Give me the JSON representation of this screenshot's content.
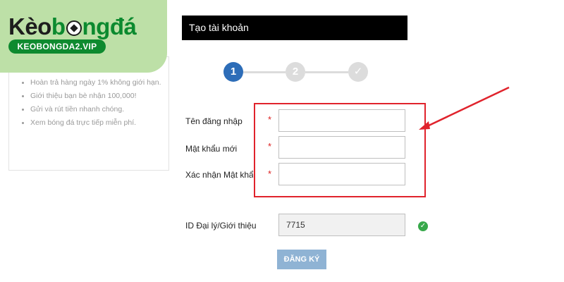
{
  "logo": {
    "part1": "Kèo",
    "part2": "b",
    "part3": "ngđá",
    "domain": "KEOBONGDA2.VIP"
  },
  "promo": {
    "top_text": "...",
    "items": [
      "Hoàn trả hàng ngày 1% không giới hạn.",
      "Giới thiệu bạn bè nhận 100,000!",
      "Gửi và rút tiền nhanh chóng.",
      "Xem bóng đá trực tiếp miễn phí."
    ]
  },
  "header": {
    "title": "Tạo tài khoản"
  },
  "stepper": {
    "steps": [
      "1",
      "2",
      "✓"
    ],
    "active_color": "#2d6db8",
    "inactive_color": "#dcdcdc"
  },
  "form": {
    "username_label": "Tên đăng nhập",
    "password_label": "Mật khẩu mới",
    "confirm_label": "Xác nhận Mật khẩu",
    "required_mark": "*",
    "username_value": "",
    "password_value": "",
    "confirm_value": "",
    "agent_label": "ID Đại lý/Giới thiệu",
    "agent_value": "7715",
    "submit_label": "ĐĂNG KÝ"
  },
  "colors": {
    "highlight": "#e0232c",
    "brand_green": "#0e8a2f",
    "logo_bg": "#bde0a7",
    "check_green": "#37a84a"
  }
}
